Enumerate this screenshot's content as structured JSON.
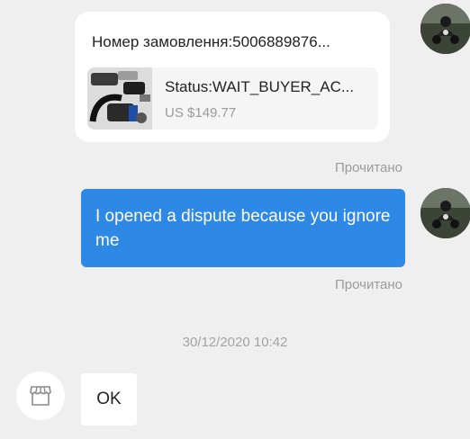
{
  "order_card": {
    "title": "Номер замовлення:5006889876...",
    "status": "Status:WAIT_BUYER_AC...",
    "price": "US $149.77",
    "read_label": "Прочитано"
  },
  "outgoing_message": {
    "text": "I opened a dispute because you ignore me",
    "read_label": "Прочитано"
  },
  "timestamp": "30/12/2020 10:42",
  "incoming_message": {
    "text": "OK"
  },
  "icons": {
    "user_avatar": "user-avatar-motorcycle",
    "shop_avatar": "shop-icon"
  },
  "colors": {
    "background": "#efefef",
    "outgoing_bubble": "#2e88e6",
    "read_label": "#9b9b9b"
  }
}
